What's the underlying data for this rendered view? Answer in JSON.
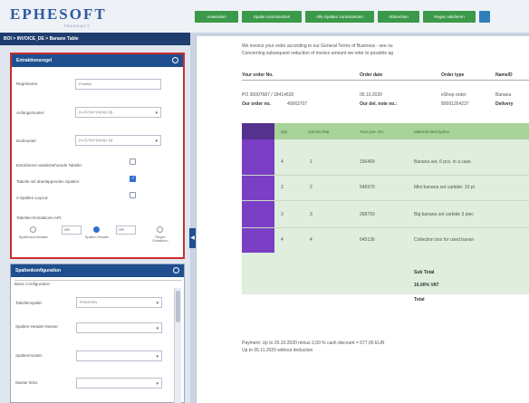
{
  "logo": {
    "main": "EPHESOFT",
    "sub": "TRANSACT"
  },
  "toolbar": {
    "buttons": [
      "Anwenden",
      "Spalte zurücksetzen",
      "Alle Spalten zurücksetzen",
      "Abbrechen",
      "Regex validieren"
    ]
  },
  "breadcrumb": "BOI > INVOICE_DE > Banane Table",
  "extraction_panel": {
    "title": "Extraktionsregel",
    "regex_label": "Regelname:",
    "regex_value": "Position",
    "start_label": "Anfangsmuster:",
    "start_value": "(\\s-Z)?(\\d+)\\s(\\d{1,3})",
    "end_label": "Endmuster:",
    "end_value": "(\\s-Z)?(\\d+)\\s(\\d{1,3})",
    "opt1": "Extrahieren wiederkehrende Tabelle:",
    "opt2": "Tabelle mit überlappenden Spalten:",
    "opt3": "2-Spalten-Layout:",
    "api_label": "Tabellen-Extraktions-API:",
    "api_opt1": "Spaltenkoordinaten",
    "api_opt2": "Spalten Header",
    "api_opt3": "Regex Extraktion",
    "and1": "OR",
    "and2": "OR"
  },
  "column_panel": {
    "title": "Spaltenkonfiguration",
    "basic": "Basic Configuration",
    "col_label": "Tabellenspalte:",
    "col_value": "POSITION",
    "header_label": "Spalten-Header-Muster:",
    "pattern_label": "Spaltenmuster:",
    "index_label": "Muster links:"
  },
  "document": {
    "intro1": "We invoice your order according to our General Terms of Business - see ou",
    "intro2": "Concerning subsequent reduction of invoice amount we refer to possible ag",
    "h_order": "Your order No.",
    "h_date": "Order date",
    "h_type": "Order type",
    "h_name": "Name/D",
    "v_order": "PO 30007687 / 18414620",
    "v_date": "05.10.2020",
    "v_type": "eShop order",
    "v_name": "Banana",
    "our_order": "Our order no.",
    "our_order_val": "40063707",
    "del_note": "Our del. note no.:",
    "del_note_val": "80091264237",
    "delivery": "Delivery",
    "table_headers": [
      "Qty.",
      "Cat No./Dat",
      "Your pos. No.",
      "Material description"
    ],
    "rows": [
      {
        "qty": "4",
        "cat": "1",
        "pos": "156409",
        "desc": "Banana set, 6 pcs. in a case"
      },
      {
        "qty": "2",
        "cat": "2",
        "pos": "546979",
        "desc": "Mini banana set carbide: 10 pi"
      },
      {
        "qty": "3",
        "cat": "3",
        "pos": "268793",
        "desc": "Big banana set carbide 3 piec"
      },
      {
        "qty": "4",
        "cat": "4",
        "pos": "645136",
        "desc": "Collection box for used banan"
      }
    ],
    "subtotal": "Sub Total",
    "vat": "16.00% VAT",
    "total": "Total",
    "payment1": "Payment: Up to 20.10.2020 minus 2,00 % cash discount = 677,00 EUR",
    "payment2": "Up to 05.11.2020 without deduction"
  }
}
